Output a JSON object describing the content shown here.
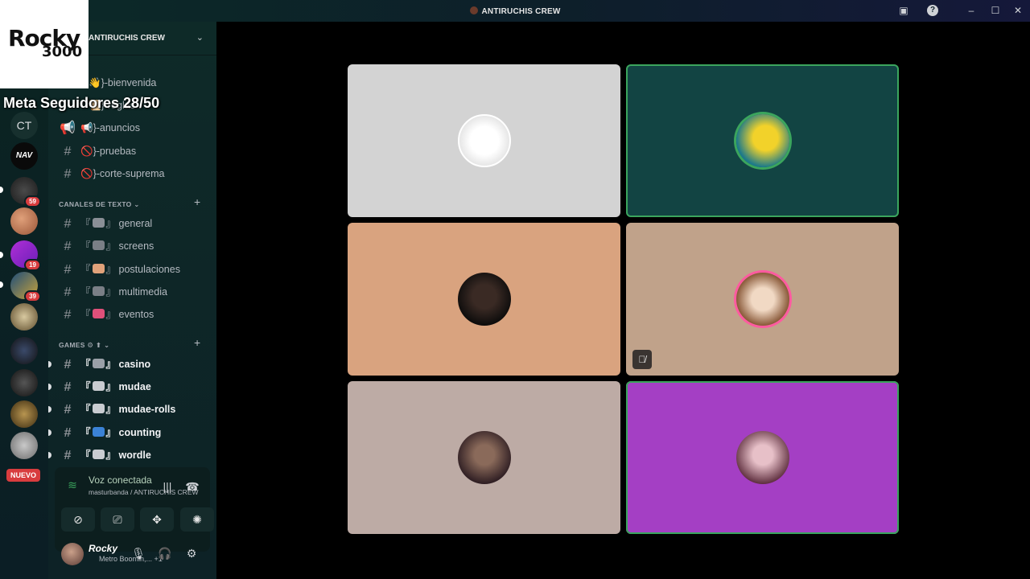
{
  "window": {
    "title": "ANTIRUCHIS CREW"
  },
  "overlay": {
    "logo_line1": "Rocky",
    "logo_line2": "3000",
    "goal_text": "Meta Seguidores 28/50"
  },
  "guilds": {
    "items": [
      {
        "label": "CT"
      },
      {
        "label": "NAV"
      },
      {
        "badge": "59"
      },
      {
        "badge": ""
      },
      {
        "badge": "19"
      },
      {
        "badge": "39"
      },
      {
        "badge": ""
      },
      {
        "badge": ""
      },
      {
        "badge": ""
      },
      {
        "badge": ""
      }
    ],
    "new_label": "NUEVO"
  },
  "server": {
    "name": "ANTIRUCHIS CREW"
  },
  "channels": {
    "top": [
      {
        "label": "👋}-bienvenida"
      },
      {
        "label": "📜}-reglas"
      },
      {
        "label": "📢}-anuncios"
      },
      {
        "label": "🚫}-pruebas"
      },
      {
        "label": "🚫}-corte-suprema"
      }
    ],
    "text_category": "CANALES DE TEXTO",
    "text": [
      {
        "label": "general"
      },
      {
        "label": "screens"
      },
      {
        "label": "postulaciones"
      },
      {
        "label": "multimedia"
      },
      {
        "label": "eventos"
      }
    ],
    "games_category": "GAMES",
    "games": [
      {
        "label": "casino"
      },
      {
        "label": "mudae"
      },
      {
        "label": "mudae-rolls"
      },
      {
        "label": "counting"
      },
      {
        "label": "wordle"
      }
    ]
  },
  "voice": {
    "status": "Voz conectada",
    "location": "masturbanda / ANTIRUCHIS CREW"
  },
  "user": {
    "name": "Rocky",
    "status": "Metro Boomin,...",
    "extra": "+1"
  },
  "colors": {
    "speaking": "#3ba55d",
    "badge": "#d83c3e",
    "tile1": "#d3d3d3",
    "tile2": "#124443",
    "tile3": "#d9a37f",
    "tile4": "#c0a28a",
    "tile5": "#bdaba5",
    "tile6": "#a43fc4"
  },
  "tiles": [
    {
      "speaking": false,
      "muted": false
    },
    {
      "speaking": true,
      "muted": false
    },
    {
      "speaking": false,
      "muted": false
    },
    {
      "speaking": false,
      "muted": true
    },
    {
      "speaking": false,
      "muted": false
    },
    {
      "speaking": true,
      "muted": false
    }
  ]
}
